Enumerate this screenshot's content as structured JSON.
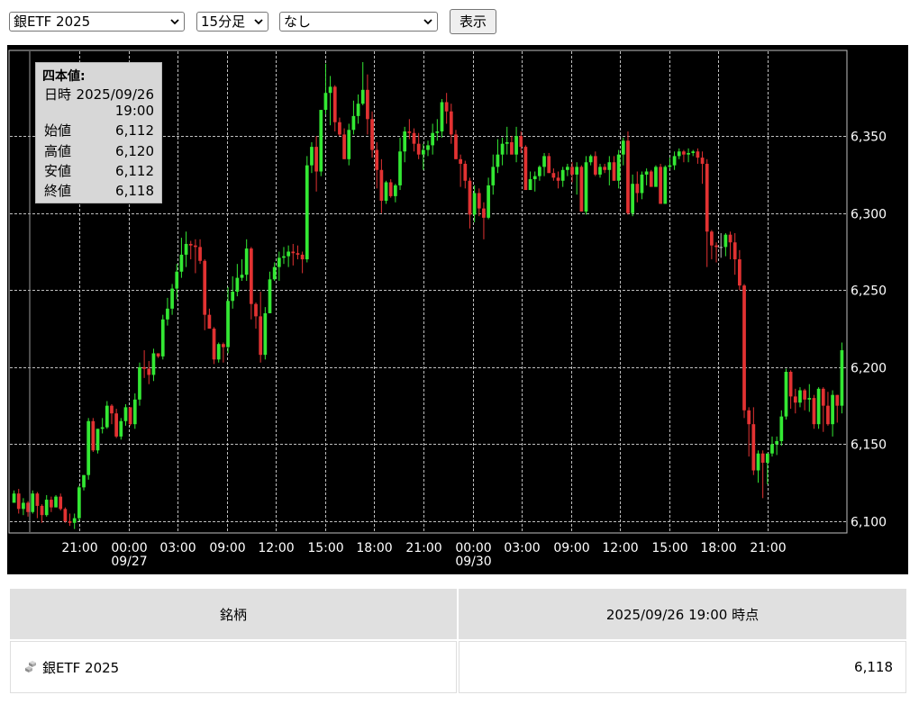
{
  "controls": {
    "symbol_select": "銀ETF 2025",
    "interval_select": "15分足",
    "indicator_select": "なし",
    "show_button": "表示"
  },
  "tooltip": {
    "header": "四本値:",
    "date_label": "日時",
    "date_value": "2025/09/26",
    "time_value": "19:00",
    "open_label": "始値",
    "open_value": "6,112",
    "high_label": "高値",
    "high_value": "6,120",
    "low_label": "安値",
    "low_value": "6,112",
    "close_label": "終値",
    "close_value": "6,118"
  },
  "chart_data": {
    "type": "candlestick",
    "title": "",
    "xlabel": "",
    "ylabel": "",
    "ylim": [
      6093,
      6405
    ],
    "yticks": [
      6100,
      6150,
      6200,
      6250,
      6300,
      6350
    ],
    "ytick_labels": [
      "6,100",
      "6,150",
      "6,200",
      "6,250",
      "6,300",
      "6,350"
    ],
    "xtick_labels": [
      {
        "time": "21:00",
        "date": ""
      },
      {
        "time": "00:00",
        "date": "09/27"
      },
      {
        "time": "03:00",
        "date": ""
      },
      {
        "time": "09:00",
        "date": ""
      },
      {
        "time": "12:00",
        "date": ""
      },
      {
        "time": "15:00",
        "date": ""
      },
      {
        "time": "18:00",
        "date": ""
      },
      {
        "time": "21:00",
        "date": ""
      },
      {
        "time": "00:00",
        "date": "09/30"
      },
      {
        "time": "03:00",
        "date": ""
      },
      {
        "time": "09:00",
        "date": ""
      },
      {
        "time": "12:00",
        "date": ""
      },
      {
        "time": "15:00",
        "date": ""
      },
      {
        "time": "18:00",
        "date": ""
      },
      {
        "time": "21:00",
        "date": ""
      }
    ],
    "grid": true,
    "colors": {
      "up": "#33e833",
      "down": "#e23232",
      "flat": "#bbbbbb",
      "background": "#000000",
      "grid": "#bfbfbf"
    },
    "candles": [
      [
        6112,
        6120,
        6112,
        6118
      ],
      [
        6118,
        6121,
        6105,
        6108
      ],
      [
        6108,
        6115,
        6104,
        6112
      ],
      [
        6112,
        6113,
        6103,
        6106
      ],
      [
        6106,
        6120,
        6105,
        6118
      ],
      [
        6118,
        6119,
        6102,
        6110
      ],
      [
        6110,
        6111,
        6099,
        6104
      ],
      [
        6104,
        6117,
        6103,
        6114
      ],
      [
        6114,
        6116,
        6106,
        6109
      ],
      [
        6109,
        6117,
        6109,
        6116
      ],
      [
        6116,
        6118,
        6107,
        6108
      ],
      [
        6108,
        6109,
        6099,
        6100
      ],
      [
        6100,
        6105,
        6097,
        6099
      ],
      [
        6099,
        6105,
        6095,
        6102
      ],
      [
        6102,
        6123,
        6100,
        6122
      ],
      [
        6122,
        6130,
        6120,
        6130
      ],
      [
        6130,
        6167,
        6127,
        6165
      ],
      [
        6165,
        6167,
        6145,
        6146
      ],
      [
        6146,
        6160,
        6144,
        6160
      ],
      [
        6160,
        6167,
        6157,
        6161
      ],
      [
        6161,
        6178,
        6160,
        6175
      ],
      [
        6175,
        6176,
        6163,
        6170
      ],
      [
        6170,
        6173,
        6154,
        6155
      ],
      [
        6155,
        6167,
        6153,
        6165
      ],
      [
        6165,
        6176,
        6162,
        6174
      ],
      [
        6174,
        6174,
        6162,
        6163
      ],
      [
        6163,
        6183,
        6160,
        6179
      ],
      [
        6179,
        6203,
        6175,
        6200
      ],
      [
        6200,
        6211,
        6193,
        6199
      ],
      [
        6199,
        6204,
        6189,
        6195
      ],
      [
        6195,
        6212,
        6191,
        6209
      ],
      [
        6209,
        6209,
        6206,
        6207
      ],
      [
        6207,
        6234,
        6205,
        6231
      ],
      [
        6231,
        6245,
        6227,
        6238
      ],
      [
        6238,
        6254,
        6234,
        6251
      ],
      [
        6251,
        6267,
        6244,
        6262
      ],
      [
        6262,
        6284,
        6258,
        6273
      ],
      [
        6273,
        6288,
        6265,
        6280
      ],
      [
        6280,
        6282,
        6270,
        6279
      ],
      [
        6279,
        6283,
        6261,
        6278
      ],
      [
        6278,
        6283,
        6267,
        6269
      ],
      [
        6269,
        6270,
        6224,
        6234
      ],
      [
        6234,
        6238,
        6225,
        6225
      ],
      [
        6225,
        6226,
        6202,
        6205
      ],
      [
        6205,
        6216,
        6203,
        6215
      ],
      [
        6215,
        6216,
        6203,
        6213
      ],
      [
        6213,
        6252,
        6209,
        6243
      ],
      [
        6243,
        6259,
        6238,
        6249
      ],
      [
        6249,
        6267,
        6246,
        6258
      ],
      [
        6258,
        6270,
        6256,
        6260
      ],
      [
        6260,
        6283,
        6256,
        6277
      ],
      [
        6277,
        6278,
        6231,
        6241
      ],
      [
        6241,
        6242,
        6225,
        6233
      ],
      [
        6233,
        6249,
        6203,
        6208
      ],
      [
        6208,
        6239,
        6205,
        6235
      ],
      [
        6235,
        6262,
        6235,
        6257
      ],
      [
        6257,
        6268,
        6256,
        6265
      ],
      [
        6265,
        6275,
        6256,
        6271
      ],
      [
        6271,
        6278,
        6267,
        6272
      ],
      [
        6272,
        6279,
        6265,
        6275
      ],
      [
        6275,
        6280,
        6266,
        6274
      ],
      [
        6274,
        6279,
        6270,
        6273
      ],
      [
        6273,
        6275,
        6261,
        6270
      ],
      [
        6270,
        6337,
        6268,
        6331
      ],
      [
        6331,
        6346,
        6326,
        6343
      ],
      [
        6343,
        6350,
        6314,
        6327
      ],
      [
        6327,
        6366,
        6324,
        6367
      ],
      [
        6367,
        6397,
        6364,
        6378
      ],
      [
        6378,
        6389,
        6357,
        6382
      ],
      [
        6382,
        6383,
        6353,
        6359
      ],
      [
        6359,
        6362,
        6350,
        6351
      ],
      [
        6351,
        6355,
        6335,
        6335
      ],
      [
        6335,
        6358,
        6331,
        6354
      ],
      [
        6354,
        6373,
        6351,
        6363
      ],
      [
        6363,
        6377,
        6358,
        6371
      ],
      [
        6371,
        6398,
        6370,
        6380
      ],
      [
        6380,
        6390,
        6351,
        6361
      ],
      [
        6361,
        6366,
        6336,
        6341
      ],
      [
        6341,
        6346,
        6316,
        6328
      ],
      [
        6328,
        6335,
        6300,
        6308
      ],
      [
        6308,
        6321,
        6306,
        6320
      ],
      [
        6320,
        6322,
        6310,
        6311
      ],
      [
        6311,
        6319,
        6307,
        6318
      ],
      [
        6318,
        6349,
        6315,
        6340
      ],
      [
        6340,
        6356,
        6333,
        6353
      ],
      [
        6353,
        6361,
        6348,
        6352
      ],
      [
        6352,
        6355,
        6340,
        6345
      ],
      [
        6345,
        6352,
        6335,
        6338
      ],
      [
        6338,
        6345,
        6328,
        6341
      ],
      [
        6341,
        6347,
        6337,
        6344
      ],
      [
        6344,
        6358,
        6338,
        6352
      ],
      [
        6352,
        6361,
        6347,
        6353
      ],
      [
        6353,
        6374,
        6349,
        6372
      ],
      [
        6372,
        6378,
        6358,
        6366
      ],
      [
        6366,
        6371,
        6345,
        6351
      ],
      [
        6351,
        6354,
        6335,
        6335
      ],
      [
        6335,
        6338,
        6317,
        6332
      ],
      [
        6332,
        6334,
        6316,
        6321
      ],
      [
        6321,
        6323,
        6290,
        6299
      ],
      [
        6299,
        6318,
        6294,
        6313
      ],
      [
        6313,
        6316,
        6298,
        6303
      ],
      [
        6303,
        6307,
        6283,
        6297
      ],
      [
        6297,
        6323,
        6296,
        6318
      ],
      [
        6318,
        6338,
        6312,
        6330
      ],
      [
        6330,
        6348,
        6326,
        6338
      ],
      [
        6338,
        6349,
        6331,
        6345
      ],
      [
        6345,
        6356,
        6338,
        6346
      ],
      [
        6346,
        6350,
        6338,
        6338
      ],
      [
        6338,
        6356,
        6333,
        6350
      ],
      [
        6350,
        6353,
        6339,
        6343
      ],
      [
        6343,
        6344,
        6318,
        6315
      ],
      [
        6315,
        6327,
        6316,
        6322
      ],
      [
        6322,
        6327,
        6314,
        6324
      ],
      [
        6324,
        6331,
        6321,
        6330
      ],
      [
        6330,
        6339,
        6324,
        6337
      ],
      [
        6337,
        6339,
        6326,
        6326
      ],
      [
        6326,
        6329,
        6321,
        6323
      ],
      [
        6323,
        6327,
        6316,
        6321
      ],
      [
        6321,
        6330,
        6317,
        6328
      ],
      [
        6328,
        6332,
        6324,
        6330
      ],
      [
        6330,
        6333,
        6320,
        6325
      ],
      [
        6325,
        6333,
        6312,
        6330
      ],
      [
        6330,
        6331,
        6301,
        6301
      ],
      [
        6301,
        6337,
        6299,
        6333
      ],
      [
        6333,
        6338,
        6331,
        6337
      ],
      [
        6337,
        6340,
        6324,
        6325
      ],
      [
        6325,
        6332,
        6323,
        6330
      ],
      [
        6330,
        6332,
        6326,
        6328
      ],
      [
        6328,
        6337,
        6318,
        6333
      ],
      [
        6333,
        6337,
        6321,
        6321
      ],
      [
        6321,
        6341,
        6316,
        6338
      ],
      [
        6338,
        6349,
        6331,
        6347
      ],
      [
        6347,
        6353,
        6299,
        6300
      ],
      [
        6300,
        6325,
        6298,
        6319
      ],
      [
        6319,
        6327,
        6307,
        6313
      ],
      [
        6313,
        6327,
        6309,
        6325
      ],
      [
        6325,
        6329,
        6318,
        6327
      ],
      [
        6327,
        6328,
        6319,
        6317
      ],
      [
        6317,
        6331,
        6319,
        6330
      ],
      [
        6330,
        6332,
        6306,
        6306
      ],
      [
        6306,
        6331,
        6306,
        6330
      ],
      [
        6330,
        6336,
        6329,
        6331
      ],
      [
        6331,
        6340,
        6328,
        6337
      ],
      [
        6337,
        6342,
        6335,
        6340
      ],
      [
        6340,
        6341,
        6333,
        6338
      ],
      [
        6338,
        6342,
        6333,
        6339
      ],
      [
        6339,
        6341,
        6337,
        6340
      ],
      [
        6340,
        6342,
        6332,
        6336
      ],
      [
        6336,
        6340,
        6319,
        6332
      ],
      [
        6332,
        6335,
        6265,
        6288
      ],
      [
        6288,
        6289,
        6270,
        6279
      ],
      [
        6279,
        6281,
        6268,
        6278
      ],
      [
        6278,
        6287,
        6271,
        6278
      ],
      [
        6278,
        6287,
        6272,
        6286
      ],
      [
        6286,
        6288,
        6270,
        6281
      ],
      [
        6281,
        6287,
        6260,
        6270
      ],
      [
        6270,
        6276,
        6250,
        6253
      ],
      [
        6253,
        6254,
        6167,
        6172
      ],
      [
        6172,
        6174,
        6142,
        6163
      ],
      [
        6163,
        6174,
        6130,
        6133
      ],
      [
        6133,
        6146,
        6125,
        6144
      ],
      [
        6144,
        6146,
        6115,
        6138
      ],
      [
        6138,
        6141,
        6124,
        6144
      ],
      [
        6144,
        6155,
        6142,
        6150
      ],
      [
        6150,
        6155,
        6143,
        6152
      ],
      [
        6152,
        6172,
        6149,
        6168
      ],
      [
        6168,
        6199,
        6166,
        6197
      ],
      [
        6197,
        6198,
        6173,
        6181
      ],
      [
        6181,
        6186,
        6170,
        6177
      ],
      [
        6177,
        6187,
        6174,
        6185
      ],
      [
        6185,
        6186,
        6172,
        6179
      ],
      [
        6179,
        6189,
        6171,
        6180
      ],
      [
        6180,
        6182,
        6160,
        6163
      ],
      [
        6163,
        6187,
        6160,
        6186
      ],
      [
        6186,
        6187,
        6158,
        6175
      ],
      [
        6175,
        6184,
        6162,
        6163
      ],
      [
        6163,
        6185,
        6155,
        6182
      ],
      [
        6182,
        6182,
        6164,
        6175
      ],
      [
        6175,
        6216,
        6170,
        6211
      ]
    ]
  },
  "table": {
    "header_name": "銘柄",
    "header_time": "2025/09/26 19:00 時点",
    "row_name": "銀ETF 2025",
    "row_value": "6,118",
    "icon": "silver-bars-icon"
  }
}
